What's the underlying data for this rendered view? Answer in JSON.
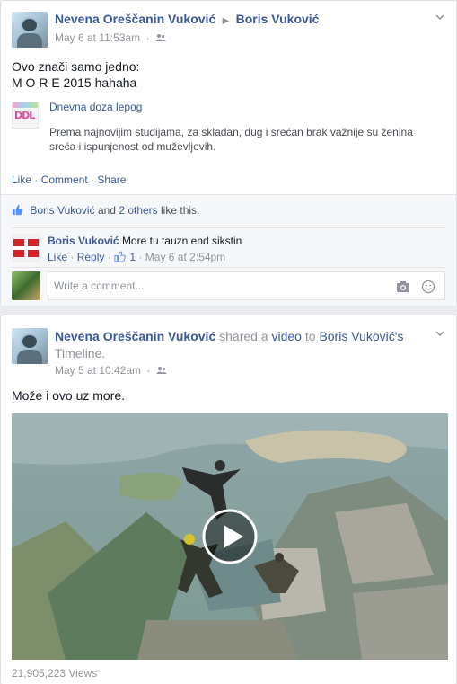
{
  "post1": {
    "author": "Nevena Oreščanin Vuković",
    "arrow": "▶",
    "target": "Boris Vuković",
    "timestamp": "May 6 at 11:53am",
    "text_line1": "Ovo znači samo jedno:",
    "text_line2": "M O R E 2015 hahaha",
    "link": {
      "logo_text": "DDL",
      "title": "Dnevna doza lepog",
      "description": "Prema najnovijim studijama, za skladan, dug i srećan brak važnije su ženina sreća i ispunjenost od muževljevih."
    },
    "actions": {
      "like": "Like",
      "comment": "Comment",
      "share": "Share",
      "sep": "·"
    },
    "likes": {
      "first": "Boris Vuković",
      "and": "and",
      "others": "2 others",
      "suffix": "like this."
    },
    "comment": {
      "author": "Boris Vuković",
      "text": "More tu tauzn end sikstin",
      "like": "Like",
      "reply": "Reply",
      "like_count": "1",
      "time": "May 6 at 2:54pm",
      "sep": "·"
    },
    "comment_placeholder": "Write a comment..."
  },
  "post2": {
    "author": "Nevena Oreščanin Vuković",
    "shared": "shared a",
    "video_word": "video",
    "to": "to",
    "target": "Boris Vuković's",
    "timeline": "Timeline.",
    "timestamp": "May 5 at 10:42am",
    "text": "Može i ovo uz more.",
    "views": "21,905,223 Views"
  },
  "icons": {
    "audience": "friends-icon",
    "chevron": "chevron-down-icon",
    "thumb": "thumbs-up-icon",
    "camera": "camera-icon",
    "emoji": "emoji-icon",
    "play": "play-icon"
  },
  "colors": {
    "link": "#3b5998",
    "meta": "#90949c",
    "ufi_bg": "#f6f7f9"
  }
}
